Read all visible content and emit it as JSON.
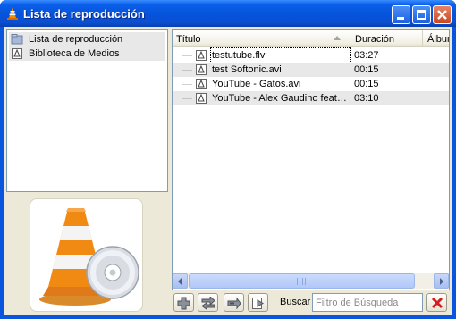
{
  "window": {
    "title": "Lista de reproducción"
  },
  "sidebar": {
    "items": [
      {
        "label": "Lista de reproducción",
        "icon": "playlist-icon"
      },
      {
        "label": "Biblioteca de Medios",
        "icon": "media-library-icon"
      }
    ]
  },
  "playlist": {
    "columns": [
      "Título",
      "Duración",
      "Álbum"
    ],
    "rows": [
      {
        "title": "testutube.flv",
        "duration": "03:27"
      },
      {
        "title": "test Softonic.avi",
        "duration": "00:15"
      },
      {
        "title": "YouTube - Gatos.avi",
        "duration": "00:15"
      },
      {
        "title": "YouTube - Alex Gaudino feat....",
        "duration": "03:10"
      }
    ]
  },
  "toolbar": {
    "buttons": [
      "add-icon",
      "shuffle-icon",
      "repeat-icon",
      "sort-icon"
    ]
  },
  "search": {
    "label": "Buscar",
    "placeholder": "Filtro de Búsqueda",
    "value": ""
  },
  "colors": {
    "titlebar": "#0653db",
    "selection_row": "#e8e8e8",
    "clear_icon": "#d21f1f"
  }
}
